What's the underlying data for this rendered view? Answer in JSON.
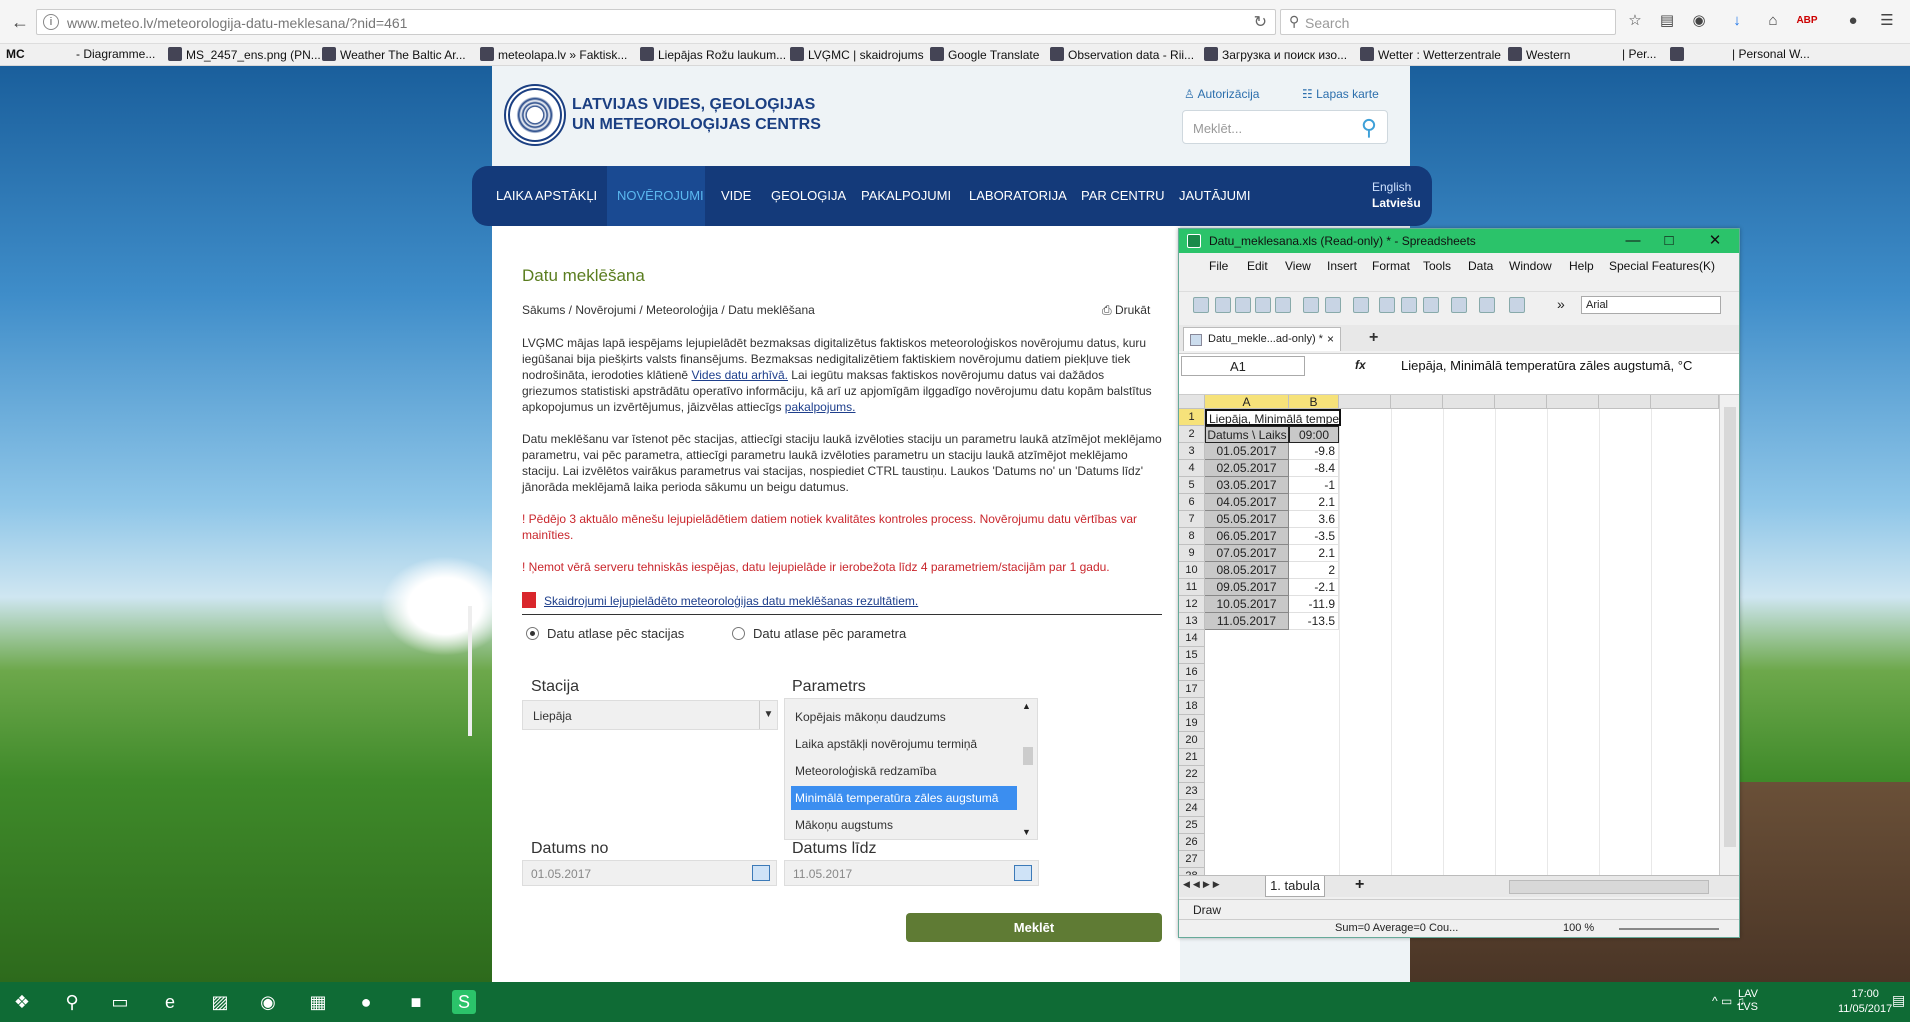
{
  "browser": {
    "url": "www.meteo.lv/meteorologija-datu-meklesana/?nid=461",
    "search_placeholder": "Search",
    "bookmarks": [
      "- Diagramme...",
      "MS_2457_ens.png (PN...",
      "Weather The Baltic Ar...",
      "meteolapa.lv » Faktisk...",
      "Liepājas Rožu laukum...",
      "LVĢMC | skaidrojums",
      "Google Translate",
      "Observation data - Rii...",
      "Загрузка и поиск изо...",
      "Wetter : Wetterzentrale",
      "Western",
      "| Per...",
      "| Personal W..."
    ],
    "bookmark_first": "MC"
  },
  "site": {
    "org_line1": "LATVIJAS VIDES, ĢEOLOĢIJAS",
    "org_line2": "UN METEOROLOĢIJAS CENTRS",
    "login": "Autorizācija",
    "sitemap": "Lapas karte",
    "search_placeholder": "Meklēt...",
    "nav": [
      "LAIKA APSTĀKĻI",
      "NOVĒROJUMI",
      "VIDE",
      "ĢEOLOĢIJA",
      "PAKALPOJUMI",
      "LABORATORIJA",
      "PAR CENTRU",
      "JAUTĀJUMI"
    ],
    "lang_en": "English",
    "lang_lv": "Latviešu"
  },
  "content": {
    "title": "Datu meklēšana",
    "breadcrumb": "Sākums / Novērojumi / Meteoroloģija / Datu meklēšana",
    "print": "Drukāt",
    "p1_a": "LVĢMC mājas lapā iespējams lejupielādēt bezmaksas digitalizētus faktiskos meteoroloģiskos novērojumu datus, kuru iegūšanai bija piešķirts valsts finansējums. Bezmaksas nedigitalizētiem faktiskiem novērojumu datiem piekļuve tiek nodrošināta, ierodoties klātienē ",
    "p1_link1": "Vides datu arhīvā.",
    "p1_b": " Lai iegūtu maksas faktiskos novērojumu datus vai dažādos griezumos statistiski apstrādātu operatīvo informāciju, kā arī uz apjomīgām ilggadīgo novērojumu datu kopām balstītus apkopojumus un izvērtējumus, jāizvēlas attiecīgs ",
    "p1_link2": "pakalpojums.",
    "p2": "Datu meklēšanu var īstenot pēc stacijas, attiecīgi staciju laukā izvēloties staciju un parametru laukā atzīmējot meklējamo parametru, vai pēc parametra, attiecīgi parametru laukā izvēloties parametru un staciju laukā atzīmējot meklējamo staciju. Lai izvēlētos vairākus parametrus vai stacijas, nospiediet CTRL taustiņu. Laukos 'Datums no' un 'Datums līdz' jānorāda meklējamā laika perioda sākumu un beigu datumus.",
    "warn1": "! Pēdējo 3 aktuālo mēnešu lejupielādētiem datiem notiek kvalitātes kontroles process. Novērojumu datu vērtības var mainīties.",
    "warn2": "! Ņemot vērā serveru tehniskās iespējas, datu lejupielāde ir ierobežota līdz 4 parametriem/stacijām par 1 gadu.",
    "pdf_link": "Skaidrojumi lejupielādēto meteoroloģijas datu meklēšanas rezultātiem.",
    "radio1": "Datu atlase pēc stacijas",
    "radio2": "Datu atlase pēc parametra",
    "station_label": "Stacija",
    "station_value": "Liepāja",
    "params_label": "Parametrs",
    "params": [
      "Kopējais mākoņu daudzums",
      "Laika apstākļi novērojumu termiņā",
      "Meteoroloģiskā redzamība",
      "Minimālā temperatūra zāles augstumā",
      "Mākoņu augstums"
    ],
    "selected_param_index": 3,
    "date_from_label": "Datums no",
    "date_from": "01.05.2017",
    "date_to_label": "Datums līdz",
    "date_to": "11.05.2017",
    "submit": "Meklēt"
  },
  "spreadsheet": {
    "title": "Datu_meklesana.xls (Read-only) * - Spreadsheets",
    "menu": [
      "File",
      "Edit",
      "View",
      "Insert",
      "Format",
      "Tools",
      "Data",
      "Window",
      "Help",
      "Special Features(K)"
    ],
    "font": "Arial",
    "tab": "Datu_mekle...ad-only) *",
    "cell_ref": "A1",
    "formula": "Liepāja, Minimālā temperatūra zāles augstumā, °C",
    "a1_display": "Liepāja, Minimālā temperatū",
    "columns": [
      "A",
      "B"
    ],
    "header_row": [
      "Datums \\ Laiks",
      "09:00"
    ],
    "rows": [
      [
        "01.05.2017",
        "-9.8"
      ],
      [
        "02.05.2017",
        "-8.4"
      ],
      [
        "03.05.2017",
        "-1"
      ],
      [
        "04.05.2017",
        "2.1"
      ],
      [
        "05.05.2017",
        "3.6"
      ],
      [
        "06.05.2017",
        "-3.5"
      ],
      [
        "07.05.2017",
        "2.1"
      ],
      [
        "08.05.2017",
        "2"
      ],
      [
        "09.05.2017",
        "-2.1"
      ],
      [
        "10.05.2017",
        "-11.9"
      ],
      [
        "11.05.2017",
        "-13.5"
      ]
    ],
    "row_count": 28,
    "sheet_tab": "1. tabula",
    "draw": "Draw",
    "status": "Sum=0 Average=0 Cou...",
    "zoom": "100 %"
  },
  "taskbar": {
    "lang1": "LAV",
    "lang2": "LVS",
    "time": "17:00",
    "date": "11/05/2017"
  },
  "colors": {
    "nav_bg": "#143a7a",
    "title_green": "#5a7d1f",
    "warn_red": "#c9262c",
    "button_green": "#5f7b34",
    "selected_blue": "#3b8ef0",
    "spreadsheet_title": "#2bc36a",
    "taskbar": "#0f6b35"
  }
}
